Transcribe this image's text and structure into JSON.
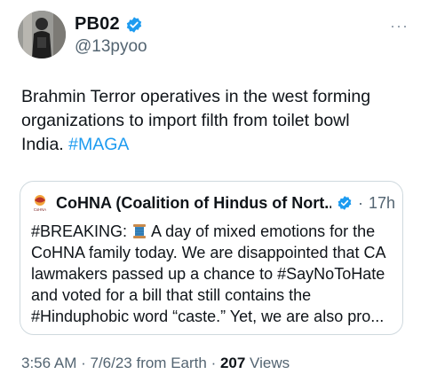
{
  "author": {
    "display_name": "PB02",
    "handle": "@13pyoo",
    "avatar_icon": "person-silhouette-avatar",
    "verified_icon": "verified-badge-icon",
    "verified_color": "#1d9bf0"
  },
  "menu": {
    "more_label": "···"
  },
  "tweet": {
    "text": "Brahmin Terror operatives in the west forming organizations to import filth from toilet bowl India. ",
    "hashtag": "#MAGA",
    "link_color": "#1d9bf0"
  },
  "quote": {
    "display_name": "CoHNA (Coalition of Hindus of Nort...",
    "logo_icon": "cohna-logo-icon",
    "verified_icon": "verified-badge-icon",
    "separator": "·",
    "time": "17h",
    "text_before_emoji": "#BREAKING: ",
    "emoji_icon": "spool-of-thread-emoji",
    "text_after_emoji": " A day of mixed emotions for the CoHNA family today. We are disappointed that CA lawmakers passed up a chance to #SayNoToHate and voted for a bill that still contains the #Hinduphobic word “caste.” Yet, we are also pro..."
  },
  "meta": {
    "time": "3:56 AM",
    "sep1": " · ",
    "date": "7/6/23",
    "source": " from Earth",
    "sep2": " · ",
    "views_count": "207",
    "views_label": " Views"
  },
  "colors": {
    "text_primary": "#0f1419",
    "text_secondary": "#536471",
    "border": "#cfd9de"
  }
}
